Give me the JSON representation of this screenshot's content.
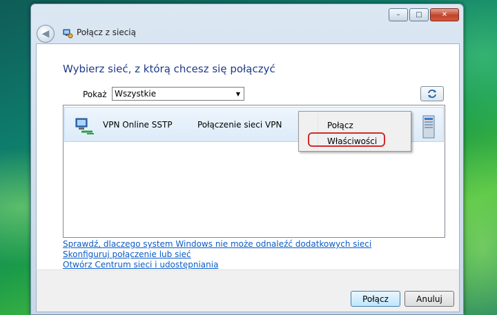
{
  "window": {
    "title": "Połącz z siecią",
    "caption_buttons": {
      "minimize": "–",
      "maximize": "□",
      "close": "✕"
    }
  },
  "main": {
    "heading": "Wybierz sieć, z którą chcesz się połączyć",
    "filter": {
      "label": "Pokaż",
      "value": "Wszystkie"
    },
    "networks": [
      {
        "name": "VPN Online SSTP",
        "type": "Połączenie sieci VPN"
      }
    ],
    "context_menu": {
      "items": [
        "Połącz",
        "Właściwości"
      ],
      "highlighted_index": 1
    },
    "links": [
      "Sprawdź, dlaczego system Windows nie może odnaleźć dodatkowych sieci",
      "Skonfiguruj połączenie lub sieć",
      "Otwórz Centrum sieci i udostępniania"
    ]
  },
  "footer": {
    "connect_label": "Połącz",
    "cancel_label": "Anuluj"
  },
  "colors": {
    "heading": "#1e3a8a",
    "link": "#0b5cc4",
    "highlight_outline": "#d12a2a"
  }
}
